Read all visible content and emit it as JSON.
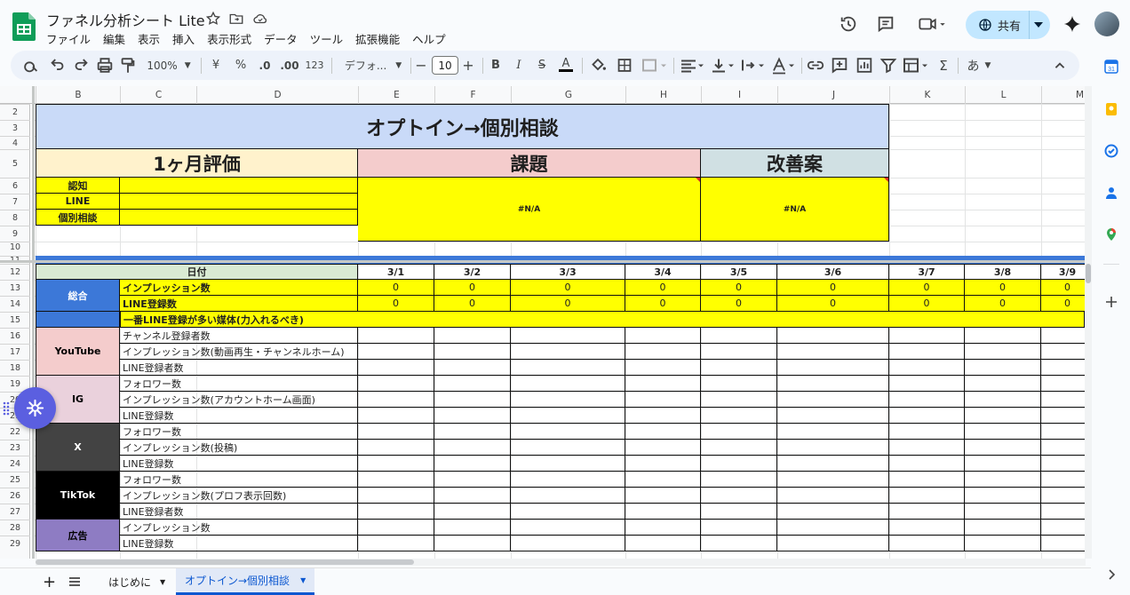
{
  "doc": {
    "title": "ファネル分析シート Lite"
  },
  "menu": [
    "ファイル",
    "編集",
    "表示",
    "挿入",
    "表示形式",
    "データ",
    "ツール",
    "拡張機能",
    "ヘルプ"
  ],
  "share": {
    "label": "共有"
  },
  "toolbar": {
    "zoom": "100%",
    "currency": "¥",
    "percent": "%",
    "dec_dec": ".0",
    "inc_dec": ".00",
    "format123": "123",
    "font": "デフォ...",
    "font_size": "10",
    "input_tool": "あ"
  },
  "columns": [
    "B",
    "C",
    "D",
    "E",
    "F",
    "G",
    "H",
    "I",
    "J",
    "K",
    "L",
    "M"
  ],
  "rows": [
    "2",
    "3",
    "4",
    "5",
    "6",
    "7",
    "8",
    "9",
    "10",
    "11",
    "12",
    "13",
    "14",
    "15",
    "16",
    "17",
    "18",
    "19",
    "20",
    "21",
    "22",
    "23",
    "24",
    "25",
    "26",
    "27",
    "28",
    "29"
  ],
  "block": {
    "title": "オプトイン→個別相談",
    "eval": "1ヶ月評価",
    "issue": "課題",
    "improve": "改善案",
    "eval_labels": [
      "認知",
      "LINE",
      "個別相談"
    ],
    "na_issue": "#N/A",
    "na_improve": "#N/A"
  },
  "table": {
    "date_header": "日付",
    "dates": [
      "3/1",
      "3/2",
      "3/3",
      "3/4",
      "3/5",
      "3/6",
      "3/7",
      "3/8",
      "3/9"
    ],
    "summary": {
      "label": "総合",
      "rows": [
        "インプレッション数",
        "LINE登録数",
        "一番LINE登録が多い媒体(力入れるべき)"
      ],
      "values": [
        [
          "0",
          "0",
          "0",
          "0",
          "0",
          "0",
          "0",
          "0",
          "0"
        ],
        [
          "0",
          "0",
          "0",
          "0",
          "0",
          "0",
          "0",
          "0",
          "0"
        ]
      ]
    },
    "groups": [
      {
        "name": "YouTube",
        "color": "#f4cccc",
        "text": "#000000",
        "rows": [
          "チャンネル登録者数",
          "インプレッション数(動画再生・チャンネルホーム)",
          "LINE登録者数"
        ]
      },
      {
        "name": "IG",
        "color": "#ead1dc",
        "text": "#000000",
        "rows": [
          "フォロワー数",
          "インプレッション数(アカウントホーム画面)",
          "LINE登録数"
        ]
      },
      {
        "name": "X",
        "color": "#434343",
        "text": "#ffffff",
        "rows": [
          "フォロワー数",
          "インプレッション数(投稿)",
          "LINE登録数"
        ]
      },
      {
        "name": "TikTok",
        "color": "#000000",
        "text": "#ffffff",
        "rows": [
          "フォロワー数",
          "インプレッション数(プロフ表示回数)",
          "LINE登録者数"
        ]
      },
      {
        "name": "広告",
        "color": "#8e7cc3",
        "text": "#000000",
        "rows": [
          "インプレッション数",
          "LINE登録数"
        ]
      }
    ]
  },
  "tabs": {
    "first": "はじめに",
    "active": "オプトイン→個別相談"
  },
  "colors": {
    "title_bg": "#c9daf8",
    "eval_bg": "#fff2cc",
    "issue_bg": "#f4cccc",
    "improve_bg": "#d0e0e3",
    "yellow": "#ffff00",
    "blue_bar": "#3c78d8",
    "date_bg": "#d9ead3",
    "summary_bg": "#3c78d8"
  }
}
